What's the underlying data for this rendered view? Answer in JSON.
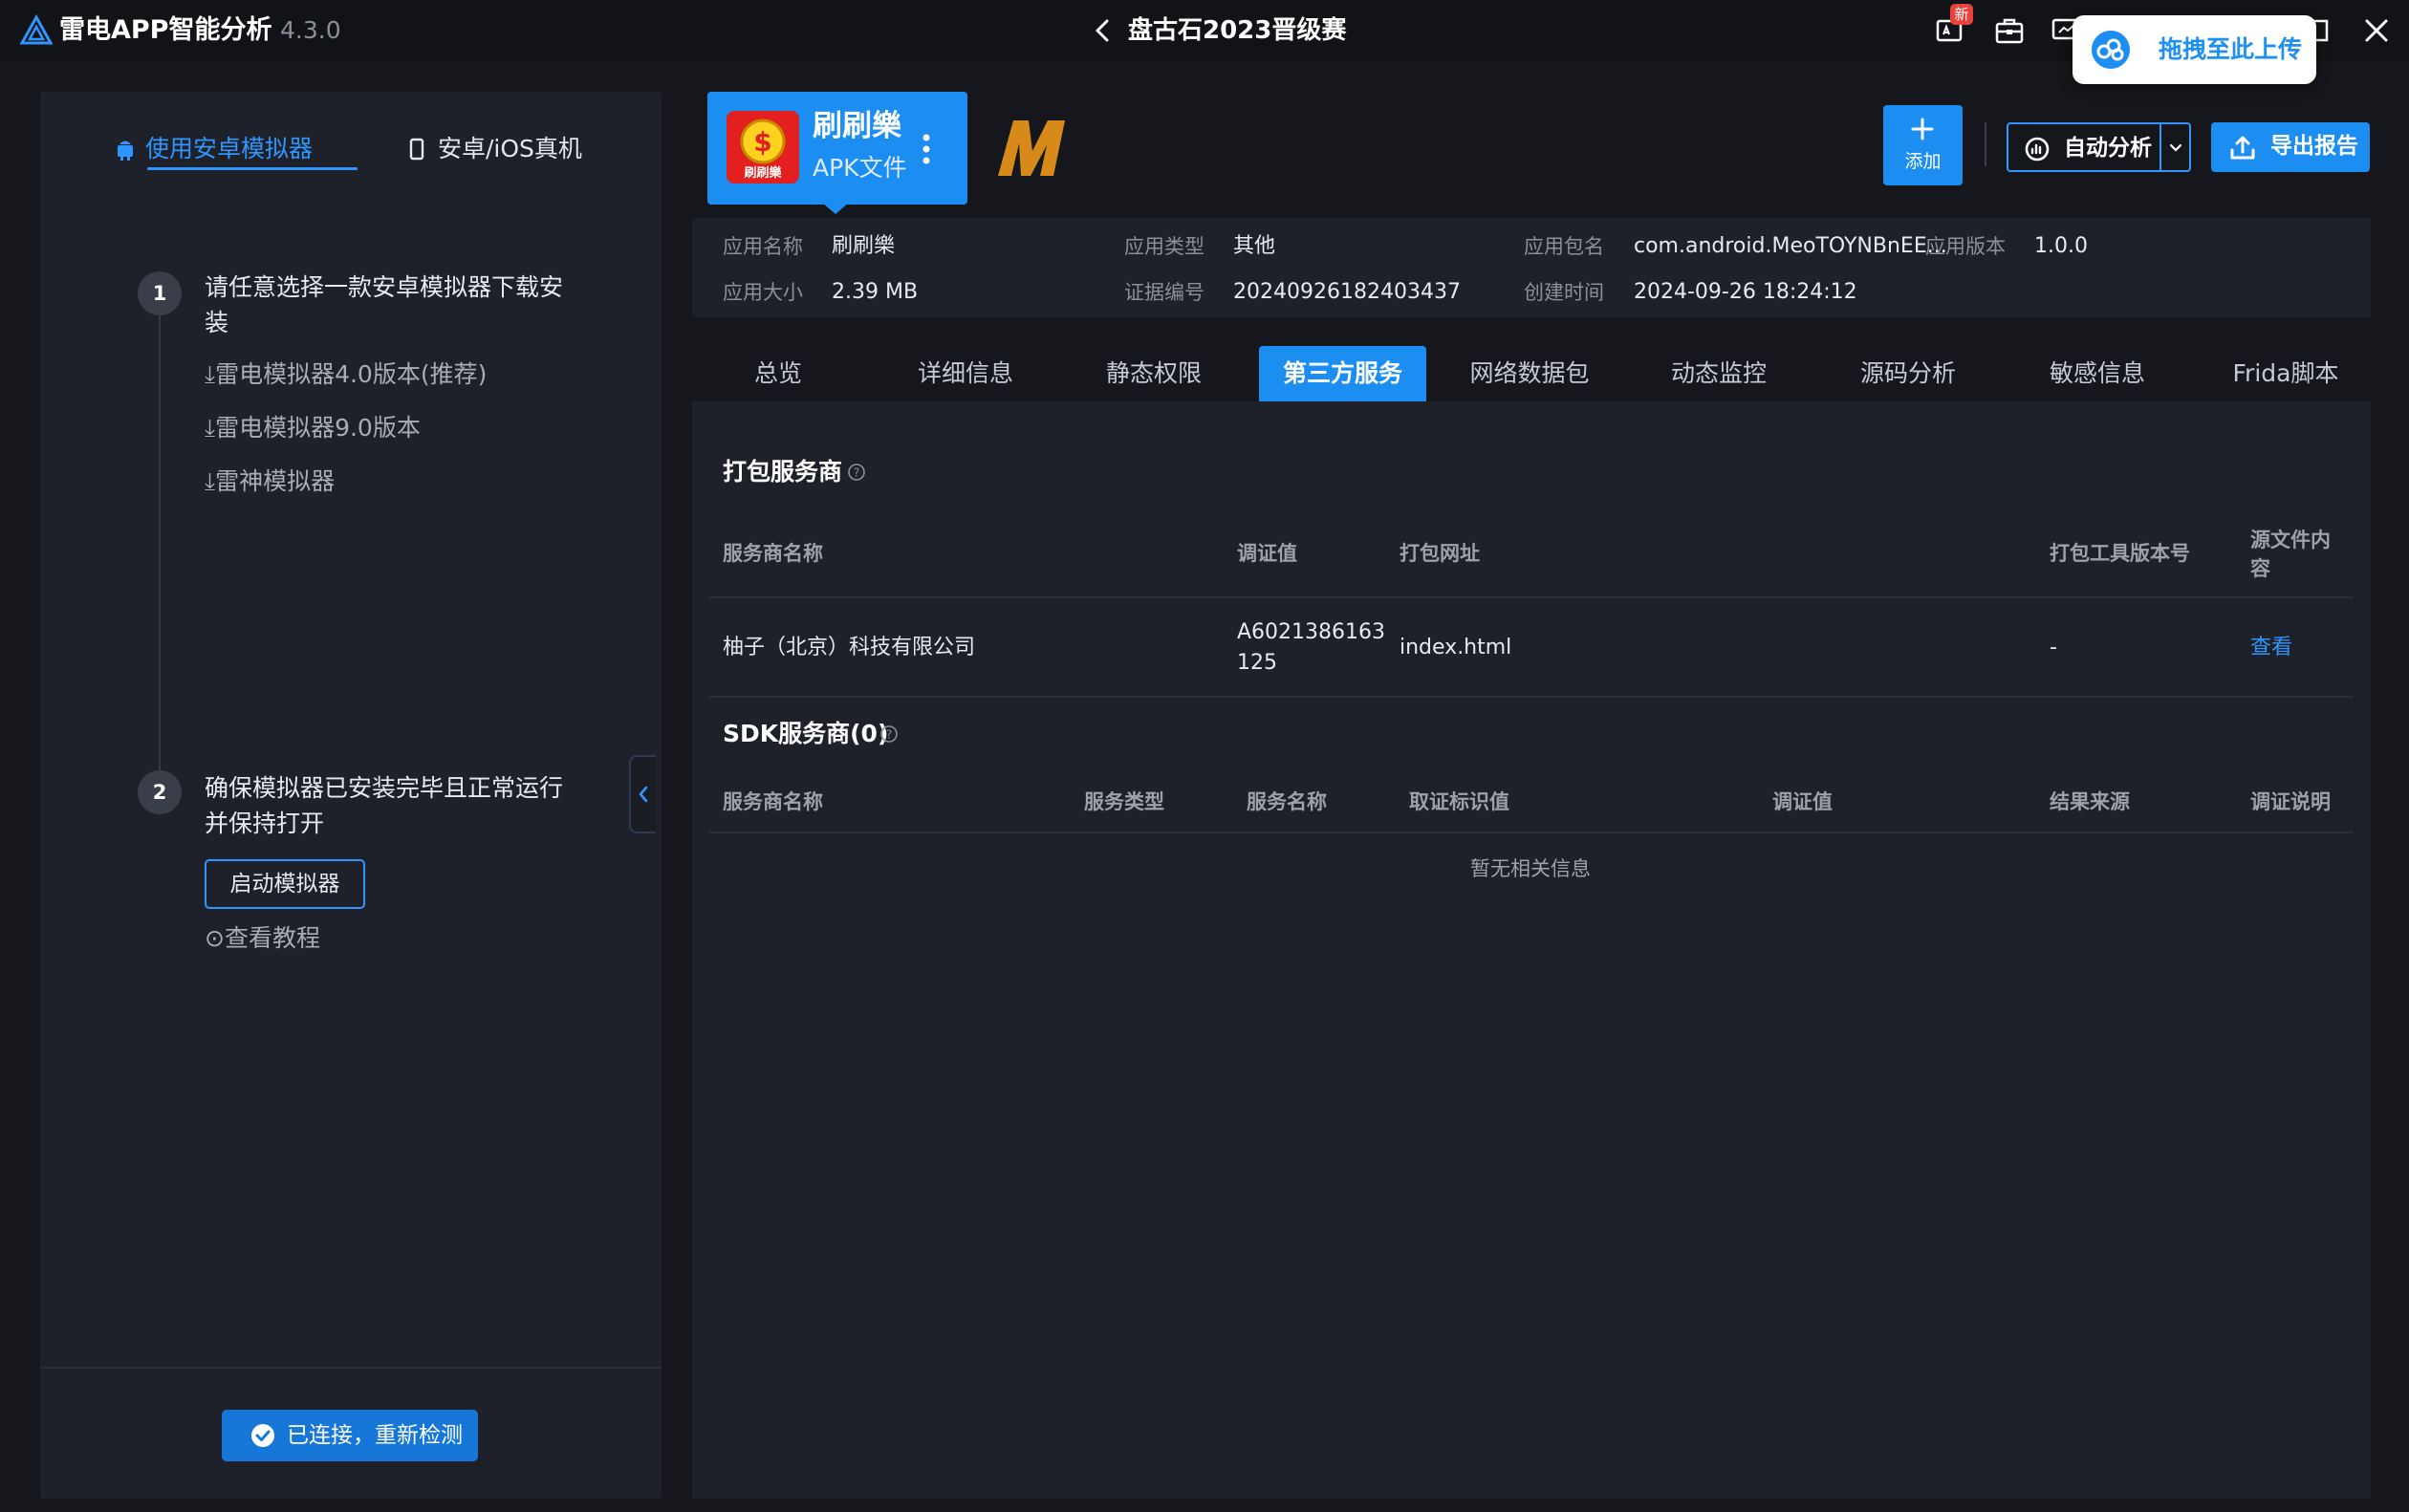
{
  "app": {
    "name": "雷电APP智能分析",
    "version": "4.3.0"
  },
  "window": {
    "title": "盘古石2023晋级赛"
  },
  "titlebar": {
    "news_badge": "新"
  },
  "upload_widget": {
    "label": "拖拽至此上传"
  },
  "left_panel": {
    "tabs": [
      {
        "label": "使用安卓模拟器",
        "active": true
      },
      {
        "label": "安卓/iOS真机",
        "active": false
      }
    ],
    "steps": [
      {
        "number": "1",
        "title": "请任意选择一款安卓模拟器下载安装",
        "links": [
          "雷电模拟器4.0版本(推荐)",
          "雷电模拟器9.0版本",
          "雷神模拟器"
        ]
      },
      {
        "number": "2",
        "title": "确保模拟器已安装完毕且正常运行并保持打开",
        "button": "启动模拟器",
        "link": "查看教程"
      }
    ],
    "reconnect_button": "已连接，重新检测"
  },
  "app_card": {
    "name": "刷刷樂",
    "type": "APK文件",
    "icon_text": "刷刷樂"
  },
  "toolbar": {
    "add_label": "添加",
    "auto_label": "自动分析",
    "export_label": "导出报告"
  },
  "info": {
    "app_name_label": "应用名称",
    "app_name": "刷刷樂",
    "app_type_label": "应用类型",
    "app_type": "其他",
    "package_label": "应用包名",
    "package": "com.android.MeoTOYNBnEE...",
    "version_label": "应用版本",
    "version": "1.0.0",
    "size_label": "应用大小",
    "size": "2.39 MB",
    "evidence_label": "证据编号",
    "evidence": "20240926182403437",
    "created_label": "创建时间",
    "created": "2024-09-26 18:24:12"
  },
  "tabs": [
    {
      "label": "总览"
    },
    {
      "label": "详细信息"
    },
    {
      "label": "静态权限"
    },
    {
      "label": "第三方服务",
      "active": true
    },
    {
      "label": "网络数据包"
    },
    {
      "label": "动态监控"
    },
    {
      "label": "源码分析"
    },
    {
      "label": "敏感信息"
    },
    {
      "label": "Frida脚本"
    }
  ],
  "packer": {
    "title": "打包服务商",
    "headers": [
      "服务商名称",
      "调证值",
      "打包网址",
      "打包工具版本号",
      "源文件内容"
    ],
    "rows": [
      [
        "柚子（北京）科技有限公司",
        "A6021386163 125",
        "index.html",
        "-",
        "查看"
      ]
    ]
  },
  "sdk": {
    "title": "SDK服务商(0)",
    "headers": [
      "服务商名称",
      "服务类型",
      "服务名称",
      "取证标识值",
      "调证值",
      "结果来源",
      "调证说明"
    ],
    "empty": "暂无相关信息"
  },
  "colors": {
    "accent": "#1c8ef2",
    "link": "#2f96ff",
    "background": "#15171c",
    "panel": "#1e2129"
  }
}
